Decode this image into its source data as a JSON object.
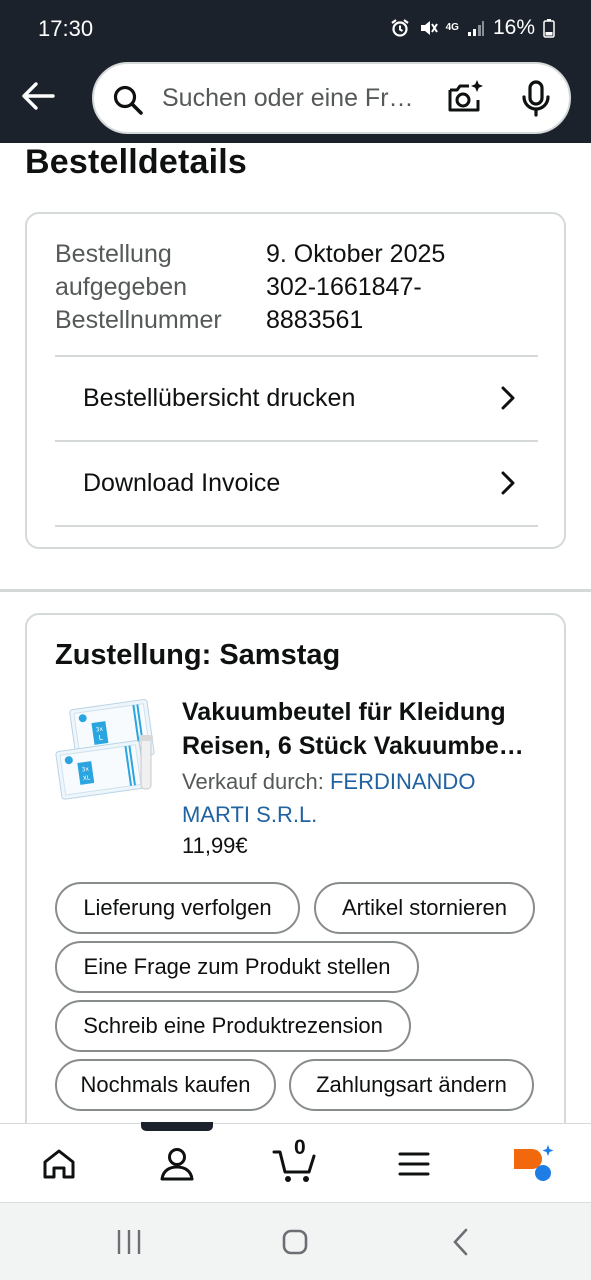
{
  "status_bar": {
    "time": "17:30",
    "network": "4G",
    "battery": "16%"
  },
  "search": {
    "placeholder": "Suchen oder eine Fr…"
  },
  "page": {
    "title": "Bestelldetails"
  },
  "order": {
    "label_lines": [
      "Bestellung",
      "aufgegeben",
      "Bestellnummer"
    ],
    "value_lines": [
      "9. Oktober 2025",
      "302-1661847-",
      "8883561"
    ],
    "links": [
      {
        "label": "Bestellübersicht drucken"
      },
      {
        "label": "Download Invoice"
      }
    ]
  },
  "delivery": {
    "title": "Zustellung: Samstag",
    "product": {
      "title_line1": "Vakuumbeutel für Kleidung",
      "title_line2": "Reisen, 6 Stück Vakuumbe…",
      "seller_prefix": "Verkauf durch: ",
      "seller_name_line1": "FERDINANDO",
      "seller_name_line2": "MARTI S.R.L.",
      "price": "11,99€",
      "image_text": {
        "top_bag": "3x",
        "top_size": "L",
        "bottom_bag": "3x",
        "bottom_size": "XL"
      }
    },
    "actions": [
      {
        "label": "Lieferung verfolgen"
      },
      {
        "label": "Artikel stornieren"
      },
      {
        "label": "Eine Frage zum Produkt stellen"
      },
      {
        "label": "Schreib eine Produktrezension"
      },
      {
        "label": "Nochmals kaufen"
      },
      {
        "label": "Zahlungsart ändern"
      }
    ]
  },
  "bottom_nav": {
    "cart_count": "0"
  },
  "colors": {
    "header_bg": "#1c222b",
    "link_blue": "#2162a1",
    "border": "#d5d9d9",
    "rufus_orange": "#f2680c",
    "rufus_blue": "#1f7ee6"
  }
}
